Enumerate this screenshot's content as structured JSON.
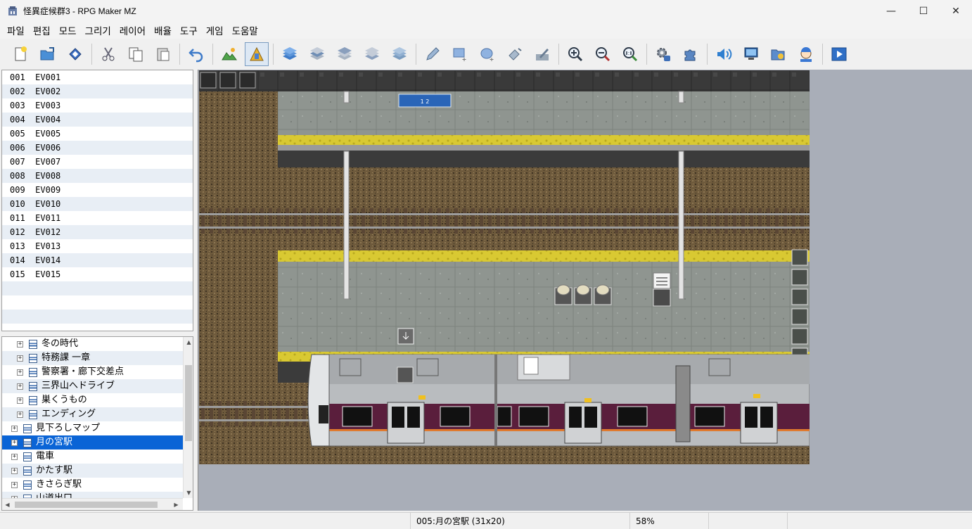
{
  "window": {
    "title": "怪異症候群3 - RPG Maker MZ",
    "minimize_glyph": "—",
    "maximize_glyph": "☐",
    "close_glyph": "✕"
  },
  "menu": [
    "파일",
    "편집",
    "모드",
    "그리기",
    "레이어",
    "배율",
    "도구",
    "게임",
    "도움말"
  ],
  "toolbar": {
    "groups": [
      [
        "new-project-icon",
        "open-project-icon",
        "save-project-icon"
      ],
      [
        "cut-icon",
        "copy-icon",
        "paste-icon"
      ],
      [
        "undo-icon"
      ],
      [
        "map-mode-icon",
        "event-mode-icon"
      ],
      [
        "layer1-icon",
        "layer2-icon",
        "layer3-icon",
        "layer4-icon",
        "all-layers-icon"
      ],
      [
        "pencil-icon",
        "rectangle-icon",
        "ellipse-icon",
        "flood-fill-icon",
        "shadow-pen-icon"
      ],
      [
        "zoom-in-icon",
        "zoom-out-icon",
        "zoom-actual-icon"
      ],
      [
        "database-icon",
        "plugin-manager-icon"
      ],
      [
        "sound-test-icon",
        "event-searcher-icon",
        "resource-manager-icon",
        "character-generator-icon"
      ],
      [
        "playtest-icon"
      ]
    ],
    "active": "event-mode-icon"
  },
  "events": [
    {
      "id": "001",
      "name": "EV001"
    },
    {
      "id": "002",
      "name": "EV002"
    },
    {
      "id": "003",
      "name": "EV003"
    },
    {
      "id": "004",
      "name": "EV004"
    },
    {
      "id": "005",
      "name": "EV005"
    },
    {
      "id": "006",
      "name": "EV006"
    },
    {
      "id": "007",
      "name": "EV007"
    },
    {
      "id": "008",
      "name": "EV008"
    },
    {
      "id": "009",
      "name": "EV009"
    },
    {
      "id": "010",
      "name": "EV010"
    },
    {
      "id": "011",
      "name": "EV011"
    },
    {
      "id": "012",
      "name": "EV012"
    },
    {
      "id": "013",
      "name": "EV013"
    },
    {
      "id": "014",
      "name": "EV014"
    },
    {
      "id": "015",
      "name": "EV015"
    }
  ],
  "map_tree": [
    {
      "label": "冬の時代",
      "level": 1,
      "selected": false
    },
    {
      "label": "特務課 一章",
      "level": 1,
      "selected": false
    },
    {
      "label": "警察署・廊下交差点",
      "level": 1,
      "selected": false
    },
    {
      "label": "三界山へドライブ",
      "level": 1,
      "selected": false
    },
    {
      "label": "巣くうもの",
      "level": 1,
      "selected": false
    },
    {
      "label": "エンディング",
      "level": 1,
      "selected": false
    },
    {
      "label": "見下ろしマップ",
      "level": 0,
      "selected": false
    },
    {
      "label": "月の宮駅",
      "level": 0,
      "selected": true
    },
    {
      "label": "電車",
      "level": 0,
      "selected": false
    },
    {
      "label": "かたす駅",
      "level": 0,
      "selected": false
    },
    {
      "label": "きさらぎ駅",
      "level": 0,
      "selected": false
    },
    {
      "label": "山道出口",
      "level": 0,
      "selected": false
    }
  ],
  "map_canvas": {
    "sign_text": "1  2"
  },
  "status": {
    "map_info": "005:月の宮駅 (31x20)",
    "zoom": "58%"
  },
  "colors": {
    "selection": "#0a64d6",
    "map_background": "#a9aeb8",
    "platform_line": "#e8dc3a",
    "train_stripe": "#5a1e3c"
  }
}
